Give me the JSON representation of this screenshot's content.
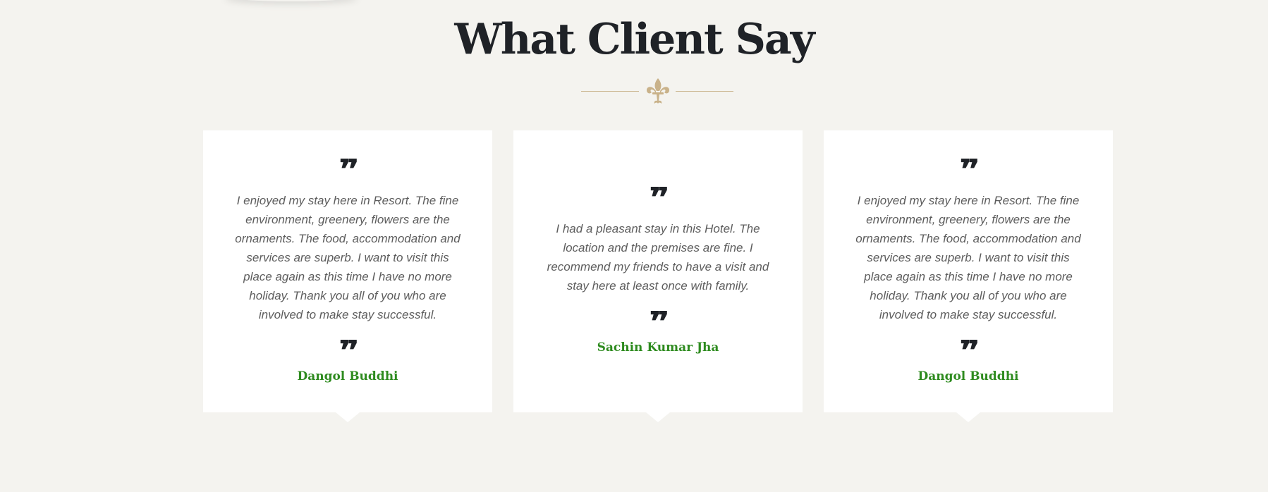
{
  "section": {
    "title": "What Client Say",
    "divider_icon": "fleur-de-lis-icon",
    "accent_color": "#c9b28a"
  },
  "colors": {
    "background": "#f4f3ef",
    "card": "#ffffff",
    "heading": "#1f2227",
    "quote_text": "#5d5d5d",
    "name": "#2e8b1f"
  },
  "testimonials": [
    {
      "open_quote": "❞",
      "text": "I enjoyed my stay here in Resort. The fine environment, greenery, flowers are the ornaments. The food, accommodation and services are superb. I want to visit this place again as this time I have no more holiday. Thank you all of you who are involved to make stay successful.",
      "close_quote": "❞",
      "name": "Dangol Buddhi"
    },
    {
      "open_quote": "❞",
      "text": "I had a pleasant stay in this Hotel. The location and the premises are fine. I recommend my friends to have a visit and stay here at least once with family.",
      "close_quote": "❞",
      "name": "Sachin Kumar Jha"
    },
    {
      "open_quote": "❞",
      "text": "I enjoyed my stay here in Resort. The fine environment, greenery, flowers are the ornaments. The food, accommodation and services are superb. I want to visit this place again as this time I have no more holiday. Thank you all of you who are involved to make stay successful.",
      "close_quote": "❞",
      "name": "Dangol Buddhi"
    }
  ]
}
